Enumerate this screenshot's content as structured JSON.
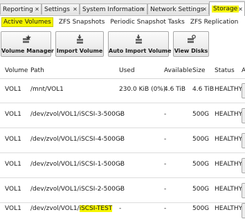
{
  "tabs": [
    {
      "label": "Reporting"
    },
    {
      "label": "Settings"
    },
    {
      "label": "System Information"
    },
    {
      "label": "Network Settings"
    },
    {
      "label": "Storage"
    }
  ],
  "subtabs": [
    {
      "label": "Active Volumes"
    },
    {
      "label": "ZFS Snapshots"
    },
    {
      "label": "Periodic Snapshot Tasks"
    },
    {
      "label": "ZFS Replication"
    }
  ],
  "toolbar": {
    "volume_manager": "Volume Manager",
    "import_volume": "Import Volume",
    "auto_import_volume": "Auto Import Volume",
    "view_disks": "View Disks"
  },
  "table": {
    "columns": {
      "volume": "Volume",
      "path": "Path",
      "used": "Used",
      "available": "Available",
      "size": "Size",
      "status": "Status",
      "extra": "A"
    },
    "rows": [
      {
        "volume": "VOL1",
        "path": "/mnt/VOL1",
        "path_highlight": "",
        "used": "230.0 KiB (0%)",
        "available": "4.6 TiB",
        "size": "4.6 TiB",
        "status": "HEALTHY"
      },
      {
        "volume": "VOL1",
        "path": "/dev/zvol/VOL1/iSCSI-3-500GB",
        "path_highlight": "",
        "used": "-",
        "available": "-",
        "size": "500G",
        "status": "HEALTHY"
      },
      {
        "volume": "VOL1",
        "path": "/dev/zvol/VOL1/iSCSI-4-500GB",
        "path_highlight": "",
        "used": "-",
        "available": "-",
        "size": "500G",
        "status": "HEALTHY"
      },
      {
        "volume": "VOL1",
        "path": "/dev/zvol/VOL1/iSCSI-1-500GB",
        "path_highlight": "",
        "used": "-",
        "available": "-",
        "size": "500G",
        "status": "HEALTHY"
      },
      {
        "volume": "VOL1",
        "path": "/dev/zvol/VOL1/iSCSI-2-500GB",
        "path_highlight": "",
        "used": "-",
        "available": "-",
        "size": "500G",
        "status": "HEALTHY"
      },
      {
        "volume": "VOL1",
        "path": "/dev/zvol/VOL1/",
        "path_highlight": "iSCSI-TEST",
        "used": "-",
        "available": "-",
        "size": "500G",
        "status": "HEALTHY"
      }
    ]
  },
  "colors": {
    "highlight": "#f5f500",
    "tab_bg": "#e9e9e9"
  }
}
